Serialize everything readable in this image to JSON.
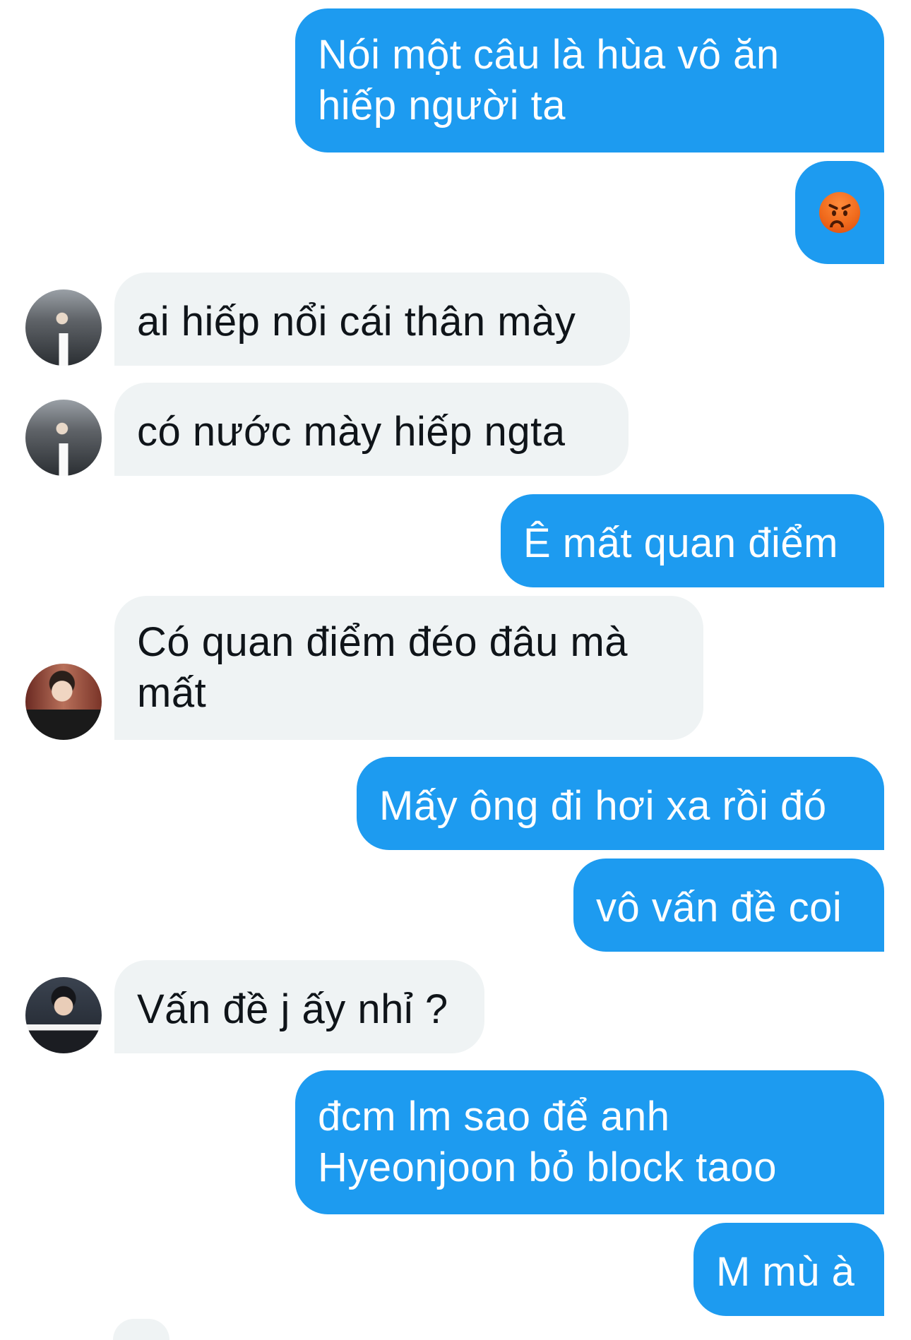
{
  "conversation": {
    "messages": [
      {
        "side": "out",
        "text": "Nói một câu là hùa vô ăn\nhiếp người ta"
      },
      {
        "side": "out",
        "emoji": "angry-face"
      },
      {
        "side": "in",
        "avatar": "avatar-1",
        "text": "ai hiếp nổi cái thân mày"
      },
      {
        "side": "in",
        "avatar": "avatar-1",
        "text": "có nước mày hiếp ngta"
      },
      {
        "side": "out",
        "text": "Ê mất quan điểm"
      },
      {
        "side": "in",
        "avatar": "avatar-2",
        "text": "Có quan điểm đéo đâu mà\nmất"
      },
      {
        "side": "out",
        "text": "Mấy ông đi hơi xa rồi đó"
      },
      {
        "side": "out",
        "text": "vô vấn đề coi"
      },
      {
        "side": "in",
        "avatar": "avatar-3",
        "text": "Vấn đề j ấy nhỉ ?"
      },
      {
        "side": "out",
        "text": "đcm lm sao để anh\nHyeonjoon bỏ block taoo"
      },
      {
        "side": "out",
        "text": "M mù à"
      }
    ]
  },
  "colors": {
    "outgoing_bubble": "#1d9bf0",
    "incoming_bubble": "#eff3f4",
    "outgoing_text": "#ffffff",
    "incoming_text": "#0f1419"
  }
}
